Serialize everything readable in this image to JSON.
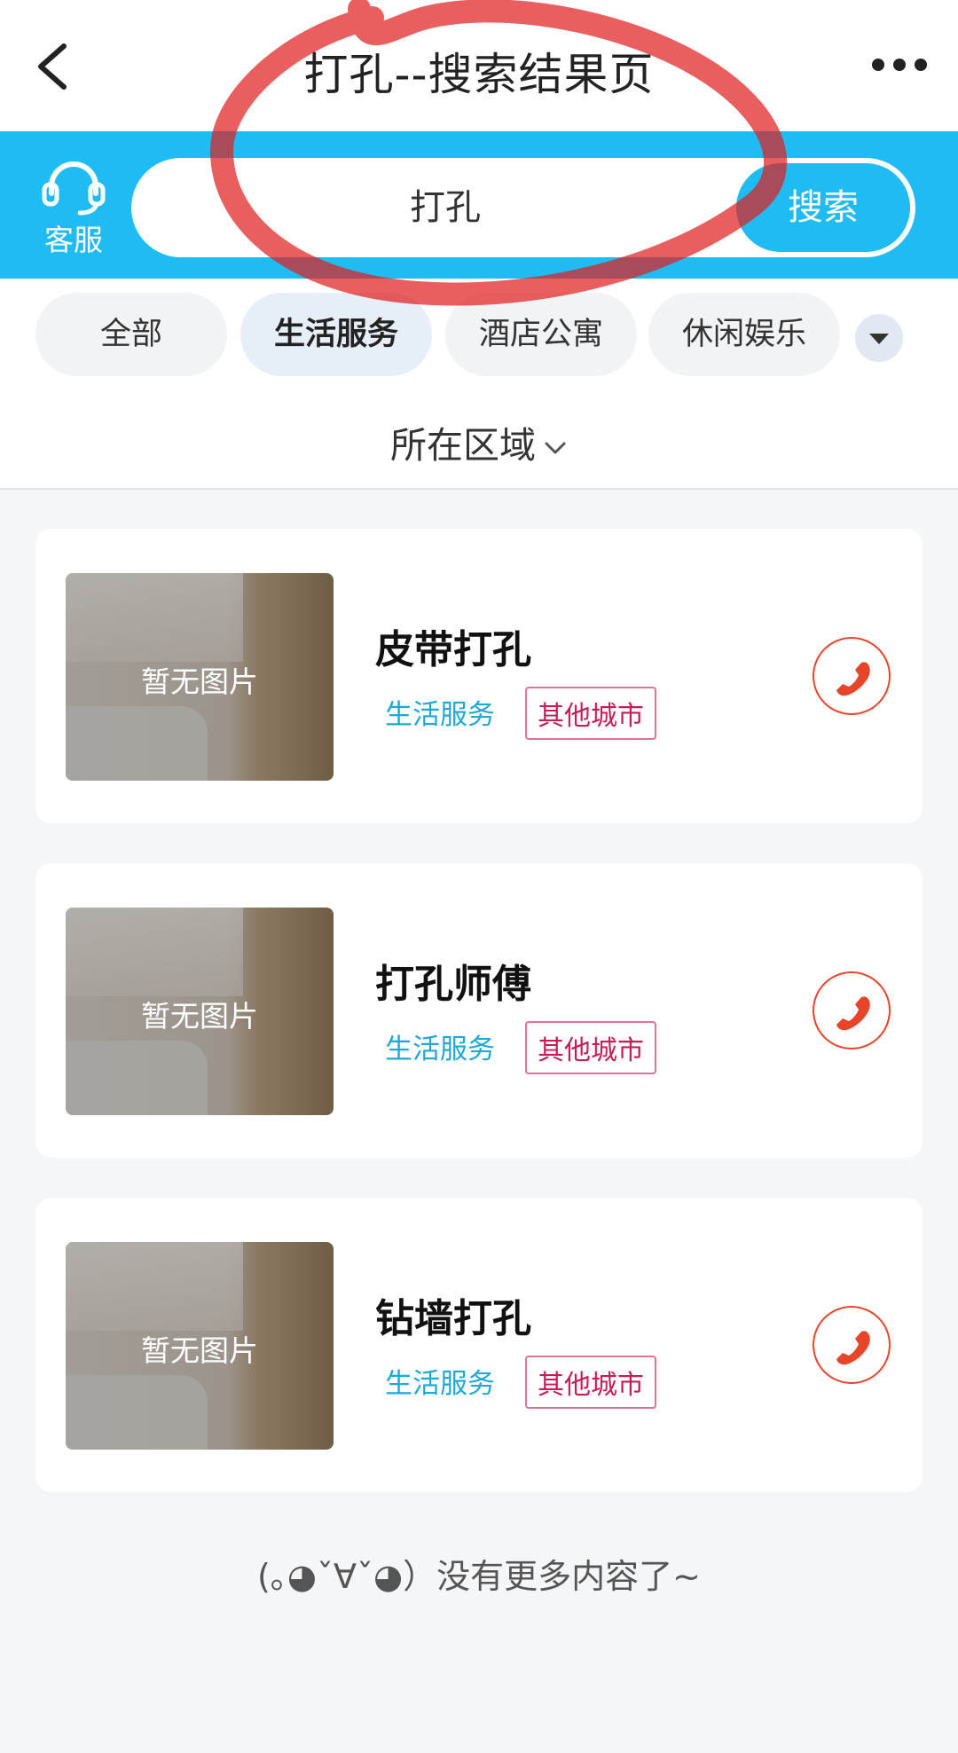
{
  "header": {
    "title": "打孔--搜索结果页"
  },
  "search": {
    "service_label": "客服",
    "query": "打孔",
    "button_label": "搜索"
  },
  "categories": [
    {
      "label": "全部",
      "active": false
    },
    {
      "label": "生活服务",
      "active": true
    },
    {
      "label": "酒店公寓",
      "active": false
    },
    {
      "label": "休闲娱乐",
      "active": false
    }
  ],
  "filter": {
    "region_label": "所在区域"
  },
  "results": [
    {
      "title": "皮带打孔",
      "image_placeholder": "暂无图片",
      "category": "生活服务",
      "city": "其他城市"
    },
    {
      "title": "打孔师傅",
      "image_placeholder": "暂无图片",
      "category": "生活服务",
      "city": "其他城市"
    },
    {
      "title": "钻墙打孔",
      "image_placeholder": "暂无图片",
      "category": "生活服务",
      "city": "其他城市"
    }
  ],
  "footer": {
    "end_text": "(｡◕ˇ∀ˇ◕）没有更多内容了~"
  },
  "colors": {
    "accent": "#1ebcf2",
    "call": "#e6452a",
    "city_tag": "#c51d57",
    "category_tag": "#1ea8d8"
  },
  "icons": {
    "back": "back-arrow-icon",
    "more": "more-dots-icon",
    "service": "headset-icon",
    "dropdown": "triangle-down-icon",
    "region": "chevron-down-icon",
    "call": "phone-icon"
  }
}
